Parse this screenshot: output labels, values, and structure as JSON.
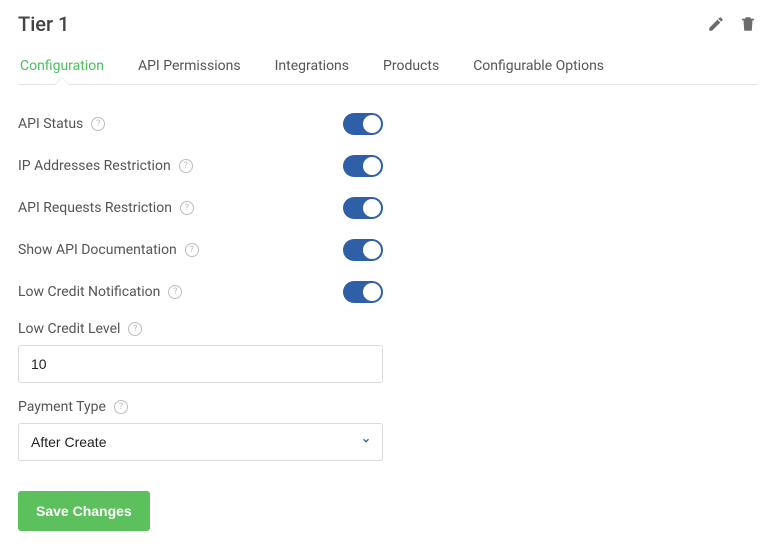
{
  "header": {
    "title": "Tier 1"
  },
  "tabs": {
    "configuration": "Configuration",
    "api_permissions": "API Permissions",
    "integrations": "Integrations",
    "products": "Products",
    "configurable_options": "Configurable Options"
  },
  "form": {
    "api_status_label": "API Status",
    "ip_restriction_label": "IP Addresses Restriction",
    "api_requests_restriction_label": "API Requests Restriction",
    "show_api_docs_label": "Show API Documentation",
    "low_credit_notification_label": "Low Credit Notification",
    "low_credit_level_label": "Low Credit Level",
    "low_credit_level_value": "10",
    "payment_type_label": "Payment Type",
    "payment_type_value": "After Create",
    "save_label": "Save Changes"
  },
  "toggles": {
    "api_status": true,
    "ip_restriction": true,
    "api_requests_restriction": true,
    "show_api_docs": true,
    "low_credit_notification": true
  },
  "icons": {
    "edit": "edit-icon",
    "delete": "delete-icon",
    "help": "?"
  }
}
